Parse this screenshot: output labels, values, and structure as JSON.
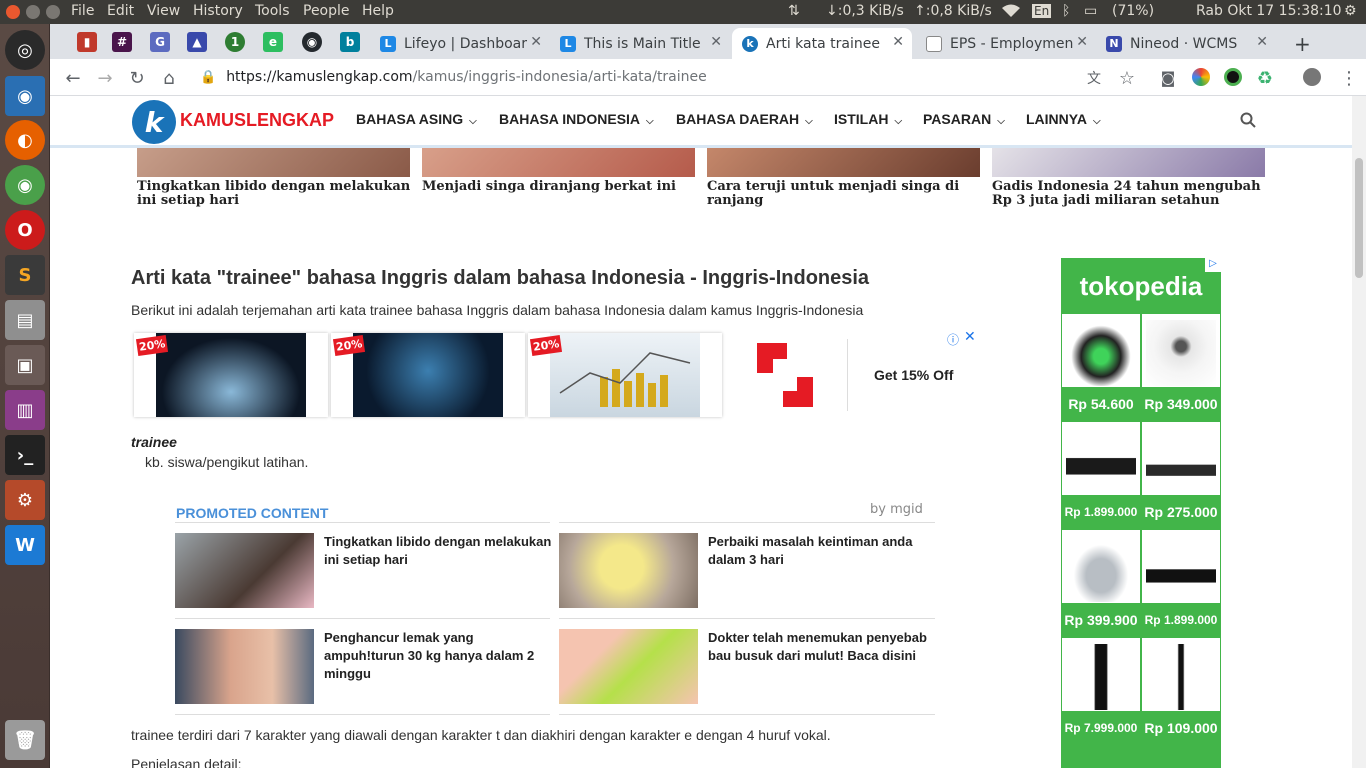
{
  "os_menu": {
    "items": [
      "File",
      "Edit",
      "View",
      "History",
      "Tools",
      "People",
      "Help"
    ]
  },
  "indicators": {
    "download": "↓:0,3 KiB/s",
    "upload": "↑:0,8 KiB/s",
    "lang": "En",
    "battery": "(71%)",
    "clock": "Rab Okt 17 15:38:10"
  },
  "tabs": [
    {
      "title": "Lifeyo | Dashboar",
      "active": false
    },
    {
      "title": "This is Main Title",
      "active": false
    },
    {
      "title": "Arti kata trainee",
      "active": true
    },
    {
      "title": "EPS - Employmen",
      "active": false
    },
    {
      "title": "Nineod · WCMS",
      "active": false
    }
  ],
  "new_tab_label": "+",
  "omnibox": {
    "host": "https://kamuslengkap.com",
    "path": "/kamus/inggris-indonesia/arti-kata/trainee"
  },
  "site": {
    "logo_text": "KAMUSLENGKAP",
    "nav": [
      "BAHASA ASING",
      "BAHASA INDONESIA",
      "BAHASA DAERAH",
      "ISTILAH",
      "PASARAN",
      "LAINNYA"
    ]
  },
  "top_cards": [
    "Tingkatkan libido dengan melakukan ini setiap hari",
    "Menjadi singa diranjang berkat ini",
    "Cara teruji untuk menjadi singa di ranjang",
    "Gadis Indonesia 24 tahun mengubah Rp 3 juta jadi miliaran setahun"
  ],
  "article": {
    "title": "Arti kata \"trainee\" bahasa Inggris dalam bahasa Indonesia - Inggris-Indonesia",
    "description": "Berikut ini adalah terjemahan arti kata trainee bahasa Inggris dalam bahasa Indonesia dalam kamus Inggris-Indonesia",
    "word": "trainee",
    "definition": "kb. siswa/pengikut latihan.",
    "summary": "trainee terdiri dari 7 karakter yang diawali dengan karakter t dan diakhiri dengan karakter e dengan 4 huruf vokal.",
    "detail_heading": "Penjelasan detail:"
  },
  "ad_banner": {
    "badges": [
      "20%",
      "20%",
      "20%"
    ],
    "cta": "Get 15% Off"
  },
  "promoted": {
    "heading": "PROMOTED CONTENT",
    "by": "by mgid",
    "items": [
      "Tingkatkan libido dengan melakukan ini setiap hari",
      "Perbaiki masalah keintiman anda dalam 3 hari",
      "Penghancur lemak yang ampuh!turun 30 kg hanya dalam 2 minggu",
      "Dokter telah menemukan penyebab bau busuk dari mulut! Baca disini"
    ]
  },
  "tokopedia": {
    "brand": "tokopedia",
    "prices": [
      "Rp 54.600",
      "Rp 349.000",
      "Rp 1.899.000",
      "Rp 275.000",
      "Rp 399.900",
      "Rp 1.899.000",
      "Rp 7.999.000",
      "Rp 109.000"
    ]
  }
}
